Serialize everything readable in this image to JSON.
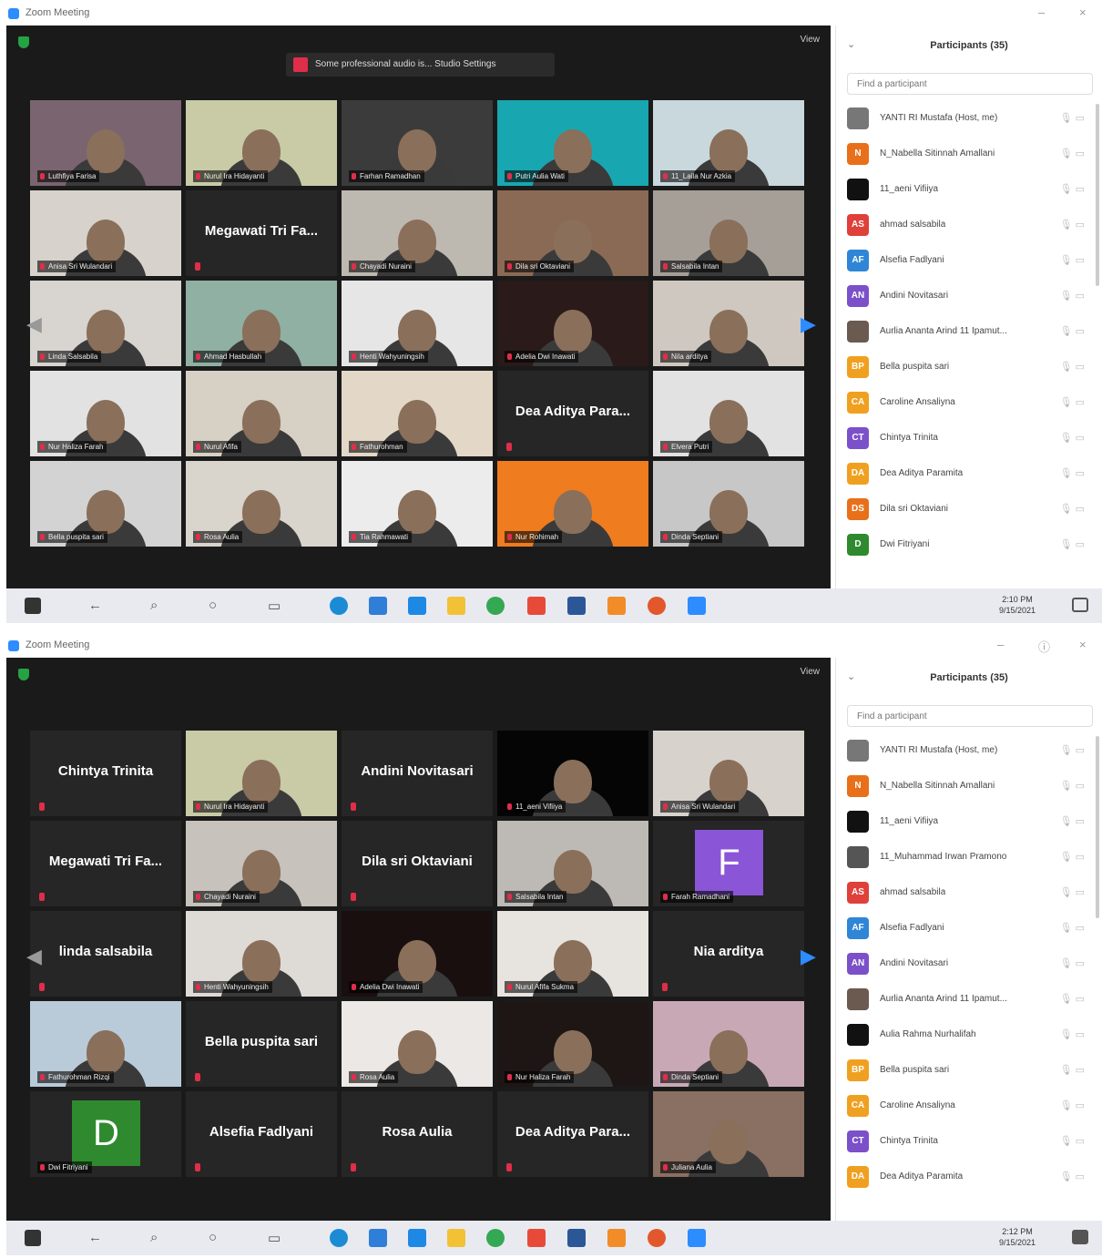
{
  "app": {
    "title": "Zoom Meeting"
  },
  "colors": {
    "zoom_blue": "#2d8cff",
    "muted_red": "#e02e4a",
    "active_speaker": "#c9d46a",
    "meeting_bg": "#1a1a1a"
  },
  "shot1": {
    "banner": "Some professional audio is... Studio Settings",
    "view_label": "View",
    "grid": [
      {
        "type": "video",
        "label": "Luthfiya Farisa",
        "bg": "#7a6470"
      },
      {
        "type": "video",
        "label": "Nurul Ira Hidayanti",
        "bg": "#c8cba6",
        "active": true
      },
      {
        "type": "video",
        "label": "Farhan Ramadhan",
        "bg": "#3b3b3b"
      },
      {
        "type": "video",
        "label": "Putri Aulia Wati",
        "bg": "#18a7b0"
      },
      {
        "type": "video",
        "label": "11_Laila Nur Azkia",
        "bg": "#c9d8dd"
      },
      {
        "type": "video",
        "label": "Anisa Sri Wulandari",
        "bg": "#d7d2cb"
      },
      {
        "type": "name",
        "name": "Megawati Tri Fa..."
      },
      {
        "type": "video",
        "label": "Chayadi Nuraini",
        "bg": "#bdb8b0"
      },
      {
        "type": "video",
        "label": "Dila sri Oktaviani",
        "bg": "#8b6a55"
      },
      {
        "type": "video",
        "label": "Salsabila Intan",
        "bg": "#a59f98"
      },
      {
        "type": "video",
        "label": "Linda Salsabila",
        "bg": "#d8d4cf"
      },
      {
        "type": "video",
        "label": "Ahmad Hasbullah",
        "bg": "#8fb0a3"
      },
      {
        "type": "video",
        "label": "Henti Wahyuningsih",
        "bg": "#e6e6e6"
      },
      {
        "type": "video",
        "label": "Adelia Dwi Inawati",
        "bg": "#2a1a1a"
      },
      {
        "type": "video",
        "label": "Nila arditya",
        "bg": "#cfc8c0"
      },
      {
        "type": "video",
        "label": "Nur Haliza Farah",
        "bg": "#e2e2e2"
      },
      {
        "type": "video",
        "label": "Nurul Afifa",
        "bg": "#d7d0c4"
      },
      {
        "type": "video",
        "label": "Fathurohman",
        "bg": "#e3d7c8"
      },
      {
        "type": "name",
        "name": "Dea Aditya Para..."
      },
      {
        "type": "video",
        "label": "Elvera Putri",
        "bg": "#e2e2e2"
      },
      {
        "type": "video",
        "label": "Bella puspita sari",
        "bg": "#d3d3d3"
      },
      {
        "type": "video",
        "label": "Rosa Aulia",
        "bg": "#d9d4cc"
      },
      {
        "type": "video",
        "label": "Tia Rahmawati",
        "bg": "#ececec"
      },
      {
        "type": "video",
        "label": "Nur Rohimah",
        "bg": "#ef7c1e"
      },
      {
        "type": "video",
        "label": "Dinda Septiani",
        "bg": "#c7c7c7"
      }
    ],
    "participants_title": "Participants (35)",
    "search_placeholder": "Find a participant",
    "participants": [
      {
        "initials": "",
        "name": "YANTI RI Mustafa (Host, me)",
        "color": "#777"
      },
      {
        "initials": "N",
        "name": "N_Nabella Sitinnah Amallani",
        "color": "#e8701a"
      },
      {
        "initials": "",
        "name": "11_aeni Vifiiya",
        "color": "#111"
      },
      {
        "initials": "AS",
        "name": "ahmad salsabila",
        "color": "#e0403a"
      },
      {
        "initials": "AF",
        "name": "Alsefia Fadlyani",
        "color": "#2f86d6"
      },
      {
        "initials": "AN",
        "name": "Andini Novitasari",
        "color": "#7b50c9"
      },
      {
        "initials": "",
        "name": "Aurlia Ananta Arind 11 Ipamut...",
        "color": "#6a5a50"
      },
      {
        "initials": "BP",
        "name": "Bella puspita sari",
        "color": "#f0a020"
      },
      {
        "initials": "CA",
        "name": "Caroline Ansaliyna",
        "color": "#f0a020"
      },
      {
        "initials": "CT",
        "name": "Chintya Trinita",
        "color": "#7b50c9"
      },
      {
        "initials": "DA",
        "name": "Dea Aditya Paramita",
        "color": "#f0a020"
      },
      {
        "initials": "DS",
        "name": "Dila sri Oktaviani",
        "color": "#e8701a"
      },
      {
        "initials": "D",
        "name": "Dwi Fitriyani",
        "color": "#2f8a2f"
      }
    ],
    "clock": {
      "time": "2:10 PM",
      "date": "9/15/2021"
    }
  },
  "shot2": {
    "view_label": "View",
    "grid": [
      {
        "type": "name",
        "name": "Chintya Trinita"
      },
      {
        "type": "video",
        "label": "Nurul Ira Hidayanti",
        "bg": "#c8cba6",
        "active": true
      },
      {
        "type": "name",
        "name": "Andini Novitasari"
      },
      {
        "type": "video",
        "label": "11_aeni Vifiiya",
        "bg": "#050505"
      },
      {
        "type": "video",
        "label": "Anisa Sri Wulandari",
        "bg": "#d8d2cc"
      },
      {
        "type": "name",
        "name": "Megawati Tri Fa..."
      },
      {
        "type": "video",
        "label": "Chayadi Nuraini",
        "bg": "#c7c2bb"
      },
      {
        "type": "name",
        "name": "Dila sri Oktaviani"
      },
      {
        "type": "video",
        "label": "Salsabila Intan",
        "bg": "#bdbab6"
      },
      {
        "type": "avatar",
        "letter": "F",
        "label": "Farah Ramadhani",
        "color": "#8a55d6"
      },
      {
        "type": "name",
        "name": "linda salsabila"
      },
      {
        "type": "video",
        "label": "Henti Wahyuningsih",
        "bg": "#dedbd6"
      },
      {
        "type": "video",
        "label": "Adelia Dwi Inawati",
        "bg": "#1a0f0f"
      },
      {
        "type": "video",
        "label": "Nurul Afifa Sukma",
        "bg": "#e7e3de"
      },
      {
        "type": "name",
        "name": "Nia arditya"
      },
      {
        "type": "video",
        "label": "Fathurohman Rizqi",
        "bg": "#b9cbd8"
      },
      {
        "type": "name",
        "name": "Bella puspita sari"
      },
      {
        "type": "video",
        "label": "Rosa Aulia",
        "bg": "#ece8e6"
      },
      {
        "type": "video",
        "label": "Nur Haliza Farah",
        "bg": "#1e1515"
      },
      {
        "type": "video",
        "label": "Dinda Septiani",
        "bg": "#c9a8b6"
      },
      {
        "type": "avatar",
        "letter": "D",
        "label": "Dwi Fitriyani",
        "color": "#2f8a2f"
      },
      {
        "type": "name",
        "name": "Alsefia Fadlyani"
      },
      {
        "type": "name",
        "name": "Rosa Aulia"
      },
      {
        "type": "name",
        "name": "Dea Aditya Para..."
      },
      {
        "type": "video",
        "label": "Juliana Aulia",
        "bg": "#8a6f63"
      }
    ],
    "participants_title": "Participants (35)",
    "search_placeholder": "Find a participant",
    "participants": [
      {
        "initials": "",
        "name": "YANTI RI Mustafa (Host, me)",
        "color": "#777"
      },
      {
        "initials": "N",
        "name": "N_Nabella Sitinnah Amallani",
        "color": "#e8701a"
      },
      {
        "initials": "",
        "name": "11_aeni Vifiiya",
        "color": "#111"
      },
      {
        "initials": "",
        "name": "11_Muhammad Irwan Pramono",
        "color": "#555"
      },
      {
        "initials": "AS",
        "name": "ahmad salsabila",
        "color": "#e0403a"
      },
      {
        "initials": "AF",
        "name": "Alsefia Fadlyani",
        "color": "#2f86d6"
      },
      {
        "initials": "AN",
        "name": "Andini Novitasari",
        "color": "#7b50c9"
      },
      {
        "initials": "",
        "name": "Aurlia Ananta Arind 11 Ipamut...",
        "color": "#6a5a50"
      },
      {
        "initials": "",
        "name": "Aulia Rahma Nurhalifah",
        "color": "#111"
      },
      {
        "initials": "BP",
        "name": "Bella puspita sari",
        "color": "#f0a020"
      },
      {
        "initials": "CA",
        "name": "Caroline Ansaliyna",
        "color": "#f0a020"
      },
      {
        "initials": "CT",
        "name": "Chintya Trinita",
        "color": "#7b50c9"
      },
      {
        "initials": "DA",
        "name": "Dea Aditya Paramita",
        "color": "#f0a020"
      }
    ],
    "clock": {
      "time": "2:12 PM",
      "date": "9/15/2021"
    }
  }
}
